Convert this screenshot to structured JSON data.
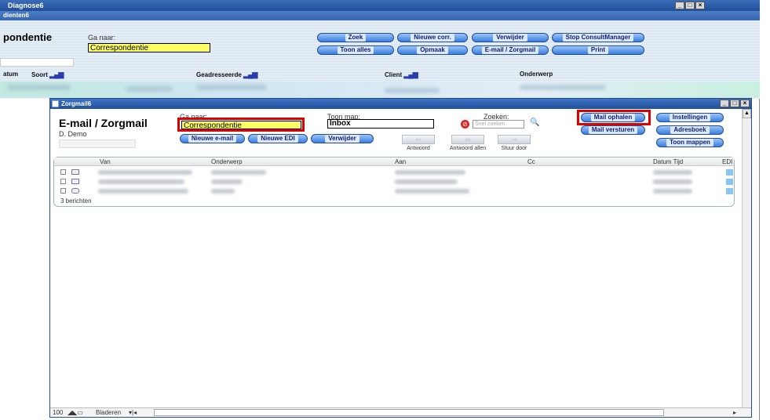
{
  "outer": {
    "title": "Diagnose6",
    "subtitle": "dienten6",
    "page_title": "pondentie",
    "goto_label": "Ga naar:",
    "goto_value": "Correspondentie",
    "buttons": [
      "Zoek",
      "Nieuwe corr.",
      "Verwijder",
      "Stop ConsultManager",
      "Toon alles",
      "Opmaak",
      "E-mail / Zorgmail",
      "Print"
    ],
    "columns": [
      "atum",
      "Soort",
      "Geadresseerde",
      "Client",
      "Onderwerp"
    ]
  },
  "zorgmail": {
    "title": "Zorgmail6",
    "heading": "E-mail / Zorgmail",
    "user": "D. Demo",
    "goto_label": "Ga naar:",
    "goto_value": "Correspondentie",
    "folder_label": "Toon map:",
    "folder_value": "Inbox",
    "search_label": "Zoeken:",
    "search_placeholder": "Snel zoeken",
    "buttons": {
      "new_email": "Nieuwe e-mail",
      "new_edi": "Nieuwe EDI",
      "delete": "Verwijder",
      "fetch_mail": "Mail ophalen",
      "send_mail": "Mail versturen",
      "settings": "Instellingen",
      "addressbook": "Adresboek",
      "show_folders": "Toon mappen"
    },
    "nav": {
      "reply": "Antwoord",
      "reply_all": "Antwoord allen",
      "forward": "Stuur door"
    },
    "columns": [
      "Van",
      "Onderwerp",
      "Aan",
      "Cc",
      "Datum Tijd",
      "EDI"
    ],
    "message_count": "3 berichten",
    "status": {
      "zoom": "100",
      "browse": "Bladeren"
    }
  },
  "colors": {
    "accent": "#1f4f99",
    "highlight": "#ffff66",
    "red_box": "#e00000"
  }
}
